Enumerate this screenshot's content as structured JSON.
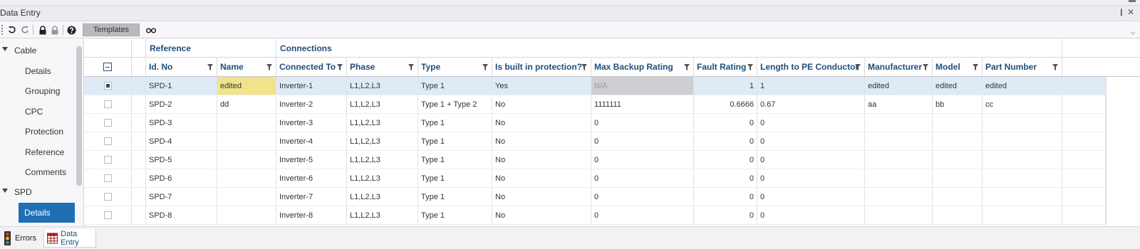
{
  "window": {
    "title": "Data Entry",
    "pin_glyph": "❙",
    "close_glyph": "✕"
  },
  "toolbar": {
    "templates_label": "Templates"
  },
  "sidebar": {
    "items": [
      {
        "label": "Cable",
        "kind": "group"
      },
      {
        "label": "Details",
        "kind": "child"
      },
      {
        "label": "Grouping",
        "kind": "child"
      },
      {
        "label": "CPC",
        "kind": "child"
      },
      {
        "label": "Protection",
        "kind": "child"
      },
      {
        "label": "Reference",
        "kind": "child"
      },
      {
        "label": "Comments",
        "kind": "child"
      },
      {
        "label": "SPD",
        "kind": "group"
      },
      {
        "label": "Details",
        "kind": "child",
        "selected": true
      }
    ]
  },
  "grid": {
    "groups": [
      {
        "label": "Reference"
      },
      {
        "label": "Connections"
      }
    ],
    "columns": [
      {
        "key": "id",
        "label": "Id. No"
      },
      {
        "key": "name",
        "label": "Name"
      },
      {
        "key": "connected_to",
        "label": "Connected To"
      },
      {
        "key": "phase",
        "label": "Phase"
      },
      {
        "key": "type",
        "label": "Type"
      },
      {
        "key": "builtin",
        "label": "Is built in protection?"
      },
      {
        "key": "max_backup",
        "label": "Max Backup Rating"
      },
      {
        "key": "fault",
        "label": "Fault Rating"
      },
      {
        "key": "length_pe",
        "label": "Length to PE Conductor"
      },
      {
        "key": "manufacturer",
        "label": "Manufacturer"
      },
      {
        "key": "model",
        "label": "Model"
      },
      {
        "key": "part",
        "label": "Part Number"
      }
    ],
    "rows": [
      {
        "selected": true,
        "id": "SPD-1",
        "name": "edited",
        "connected_to": "Inverter-1",
        "phase": "L1,L2,L3",
        "type": "Type 1",
        "builtin": "Yes",
        "max_backup": "N/A",
        "fault": "1",
        "length_pe": "1",
        "manufacturer": "edited",
        "model": "edited",
        "part": "edited"
      },
      {
        "selected": false,
        "id": "SPD-2",
        "name": "dd",
        "connected_to": "Inverter-2",
        "phase": "L1,L2,L3",
        "type": "Type 1 + Type 2",
        "builtin": "No",
        "max_backup": "1111111",
        "fault": "0.6666",
        "length_pe": "0.67",
        "manufacturer": "aa",
        "model": "bb",
        "part": "cc"
      },
      {
        "selected": false,
        "id": "SPD-3",
        "name": "",
        "connected_to": "Inverter-3",
        "phase": "L1,L2,L3",
        "type": "Type 1",
        "builtin": "No",
        "max_backup": "0",
        "fault": "0",
        "length_pe": "0",
        "manufacturer": "",
        "model": "",
        "part": ""
      },
      {
        "selected": false,
        "id": "SPD-4",
        "name": "",
        "connected_to": "Inverter-4",
        "phase": "L1,L2,L3",
        "type": "Type 1",
        "builtin": "No",
        "max_backup": "0",
        "fault": "0",
        "length_pe": "0",
        "manufacturer": "",
        "model": "",
        "part": ""
      },
      {
        "selected": false,
        "id": "SPD-5",
        "name": "",
        "connected_to": "Inverter-5",
        "phase": "L1,L2,L3",
        "type": "Type 1",
        "builtin": "No",
        "max_backup": "0",
        "fault": "0",
        "length_pe": "0",
        "manufacturer": "",
        "model": "",
        "part": ""
      },
      {
        "selected": false,
        "id": "SPD-6",
        "name": "",
        "connected_to": "Inverter-6",
        "phase": "L1,L2,L3",
        "type": "Type 1",
        "builtin": "No",
        "max_backup": "0",
        "fault": "0",
        "length_pe": "0",
        "manufacturer": "",
        "model": "",
        "part": ""
      },
      {
        "selected": false,
        "id": "SPD-7",
        "name": "",
        "connected_to": "Inverter-7",
        "phase": "L1,L2,L3",
        "type": "Type 1",
        "builtin": "No",
        "max_backup": "0",
        "fault": "0",
        "length_pe": "0",
        "manufacturer": "",
        "model": "",
        "part": ""
      },
      {
        "selected": false,
        "id": "SPD-8",
        "name": "",
        "connected_to": "Inverter-8",
        "phase": "L1,L2,L3",
        "type": "Type 1",
        "builtin": "No",
        "max_backup": "0",
        "fault": "0",
        "length_pe": "0",
        "manufacturer": "",
        "model": "",
        "part": ""
      }
    ]
  },
  "statusbar": {
    "tabs": [
      {
        "label": "Errors",
        "icon": "traffic-light-icon"
      },
      {
        "label": "Data Entry",
        "icon": "grid-table-icon"
      }
    ]
  },
  "colors": {
    "accent": "#1e6fb3",
    "header_text": "#1f4e79",
    "selected_row": "#deebf7",
    "edited_cell": "#f0e38a",
    "disabled_cell": "#cfcfd3"
  }
}
